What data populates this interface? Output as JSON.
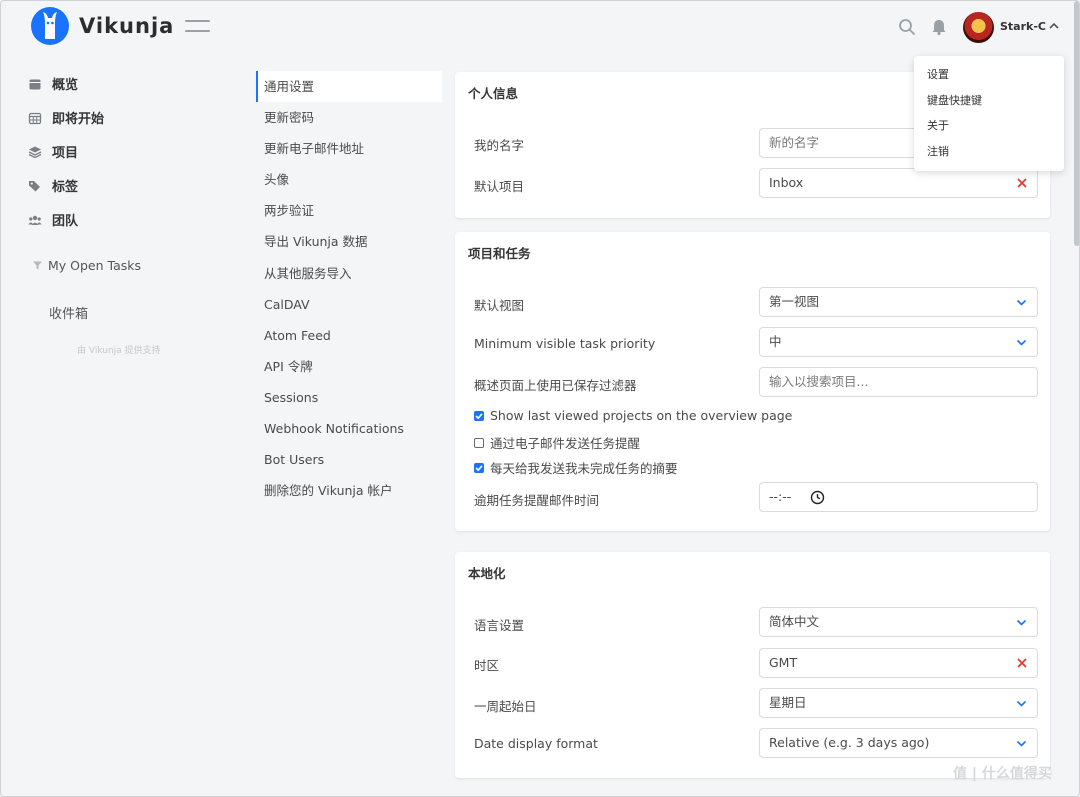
{
  "app": {
    "name": "Vikunja"
  },
  "header": {
    "username": "Stark-C"
  },
  "user_menu": [
    {
      "label": "设置"
    },
    {
      "label": "键盘快捷键"
    },
    {
      "label": "关于"
    },
    {
      "label": "注销"
    }
  ],
  "sidebar": {
    "items": [
      {
        "label": "概览",
        "icon": "calendar-icon"
      },
      {
        "label": "即将开始",
        "icon": "calendar-grid-icon"
      },
      {
        "label": "项目",
        "icon": "layers-icon"
      },
      {
        "label": "标签",
        "icon": "tags-icon"
      },
      {
        "label": "团队",
        "icon": "users-icon"
      }
    ],
    "filter": "My Open Tasks",
    "inbox": "收件箱",
    "powered_by": "由 Vikunja 提供支持"
  },
  "settings_menu": [
    "通用设置",
    "更新密码",
    "更新电子邮件地址",
    "头像",
    "两步验证",
    "导出 Vikunja 数据",
    "从其他服务导入",
    "CalDAV",
    "Atom Feed",
    "API 令牌",
    "Sessions",
    "Webhook Notifications",
    "Bot Users",
    "删除您的 Vikunja 帐户"
  ],
  "personal": {
    "title": "个人信息",
    "name_label": "我的名字",
    "name_placeholder": "新的名字",
    "default_project_label": "默认项目",
    "default_project_value": "Inbox"
  },
  "projects_tasks": {
    "title": "项目和任务",
    "default_view_label": "默认视图",
    "default_view_value": "第一视图",
    "min_priority_label": "Minimum visible task priority",
    "min_priority_value": "中",
    "saved_filter_label": "概述页面上使用已保存过滤器",
    "saved_filter_placeholder": "输入以搜索项目...",
    "checks": [
      {
        "label": "Show last viewed projects on the overview page",
        "checked": true
      },
      {
        "label": "通过电子邮件发送任务提醒",
        "checked": false
      },
      {
        "label": "每天给我发送我未完成任务的摘要",
        "checked": true
      }
    ],
    "overdue_time_label": "逾期任务提醒邮件时间",
    "overdue_time_value": "--:--"
  },
  "localization": {
    "title": "本地化",
    "language_label": "语言设置",
    "language_value": "简体中文",
    "timezone_label": "时区",
    "timezone_value": "GMT",
    "week_start_label": "一周起始日",
    "week_start_value": "星期日",
    "date_format_label": "Date display format",
    "date_format_value": "Relative (e.g. 3 days ago)"
  },
  "watermark": "值 | 什么值得买",
  "colors": {
    "accent": "#1973ff",
    "clear": "#e53935"
  }
}
